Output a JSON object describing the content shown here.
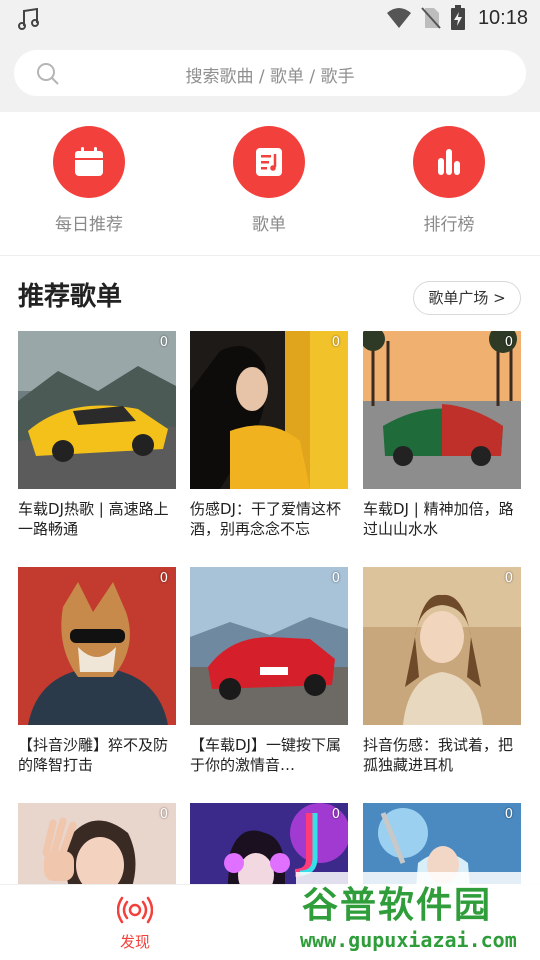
{
  "status_bar": {
    "time": "10:18",
    "icons": [
      "music-note-icon",
      "wifi-icon",
      "no-sim-icon",
      "battery-charging-icon"
    ]
  },
  "search": {
    "placeholder": "搜索歌曲 / 歌单 / 歌手"
  },
  "quick_actions": [
    {
      "label": "每日推荐",
      "icon": "calendar-icon"
    },
    {
      "label": "歌单",
      "icon": "playlist-icon"
    },
    {
      "label": "排行榜",
      "icon": "chart-bars-icon"
    }
  ],
  "recommend": {
    "title": "推荐歌单",
    "more_label": "歌单广场 >",
    "playlists": [
      {
        "title": "车载DJ热歌 | 高速路上一路畅通",
        "count": "0"
      },
      {
        "title": "伤感DJ：干了爱情这杯酒，别再念念不忘",
        "count": "0"
      },
      {
        "title": "车载DJ | 精神加倍，路过山山水水",
        "count": "0"
      },
      {
        "title": "【抖音沙雕】猝不及防的降智打击",
        "count": "0"
      },
      {
        "title": "【车载DJ】一键按下属于你的激情音…",
        "count": "0"
      },
      {
        "title": "抖音伤感：我试着，把孤独藏进耳机",
        "count": "0"
      },
      {
        "title": "",
        "count": "0"
      },
      {
        "title": "",
        "count": "0"
      },
      {
        "title": "",
        "count": "0"
      }
    ]
  },
  "bottom_nav": {
    "discover_label": "发现"
  },
  "watermark": {
    "title": "谷普软件园",
    "url": "www.gupuxiazai.com"
  },
  "colors": {
    "accent": "#f2413c",
    "watermark_green": "#2e9d3a"
  }
}
